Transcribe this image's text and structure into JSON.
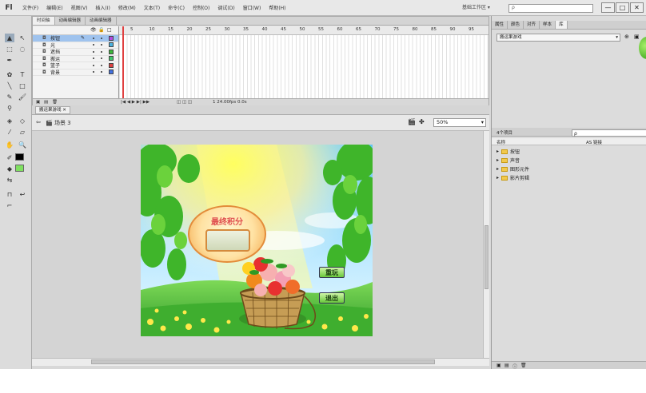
{
  "app": {
    "logo": "Fl",
    "menu": [
      "文件(F)",
      "编辑(E)",
      "视图(V)",
      "插入(I)",
      "修改(M)",
      "文本(T)",
      "命令(C)",
      "控制(O)",
      "调试(D)",
      "窗口(W)",
      "帮助(H)"
    ],
    "workspace_label": "基础工作区",
    "search_placeholder": "ρ",
    "window_buttons": [
      "—",
      "□",
      "✕"
    ]
  },
  "timeline": {
    "tabs": [
      "时间轴",
      "动画编辑器",
      "动画编辑器"
    ],
    "ruler_ticks": [
      "5",
      "10",
      "15",
      "20",
      "25",
      "30",
      "35",
      "40",
      "45",
      "50",
      "55",
      "60",
      "65",
      "70",
      "75",
      "80",
      "85",
      "90",
      "95"
    ],
    "layers": [
      {
        "name": "按钮",
        "selected": true,
        "color": "#b44ae0"
      },
      {
        "name": "光",
        "selected": false,
        "color": "#4ab2e0"
      },
      {
        "name": "遮挡",
        "selected": false,
        "color": "#3ab83a"
      },
      {
        "name": "搬运",
        "selected": false,
        "color": "#40c86a"
      },
      {
        "name": "篮子",
        "selected": false,
        "color": "#e04040"
      },
      {
        "name": "背景",
        "selected": false,
        "color": "#4070e0"
      }
    ],
    "status": "1  24.00fps  0.0s"
  },
  "document": {
    "tab": "搬运果游戏",
    "scene": "场景 3",
    "zoom": "50%"
  },
  "stage": {
    "score_title": "最终积分",
    "restart_label": "重玩",
    "exit_label": "退出"
  },
  "right_panel": {
    "tabs": [
      "属性",
      "颜色",
      "对齐",
      "样本",
      "库"
    ],
    "document_combo": "搬运果游戏",
    "library_count": "4个项目",
    "columns": [
      "名称",
      "AS 链接"
    ],
    "items": [
      "按钮",
      "声音",
      "图形元件",
      "影片剪辑"
    ]
  },
  "colors": {
    "stroke_swatch": "#000000",
    "fill_swatch": "#7fe060"
  }
}
